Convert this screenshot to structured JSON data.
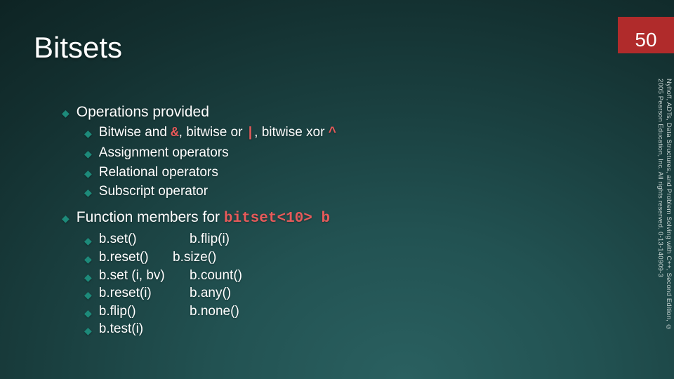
{
  "title": "Bitsets",
  "page_number": "50",
  "footer_citation": "Nyhoff, ADTs, Data Structures, and Problem Solving with C++, Second Edition, © 2005 Pearson Education, Inc. All rights reserved. 0-13-140909-3",
  "sections": {
    "ops_heading": "Operations provided",
    "ops": {
      "bitwise_pre": "Bitwise and ",
      "bitwise_and": "&",
      "bitwise_mid1": ", bitwise or ",
      "bitwise_or": "|",
      "bitwise_mid2": ", bitwise xor ",
      "bitwise_xor": "^",
      "assignment": "Assignment operators",
      "relational": "Relational operators",
      "subscript": "Subscript operator"
    },
    "func_heading_pre": "Function members for ",
    "func_heading_code": "bitset<10> b",
    "funcs": {
      "r1c1": "b.set()",
      "r1c2": "b.flip(i)",
      "r2c1": "b.reset()",
      "r2c2": "b.size()",
      "r3c1": "b.set (i, bv)",
      "r3c2": "b.count()",
      "r4c1": "b.reset(i)",
      "r4c2": "b.any()",
      "r5c1": "b.flip()",
      "r5c2": "b.none()",
      "r6c1": "b.test(i)"
    }
  }
}
